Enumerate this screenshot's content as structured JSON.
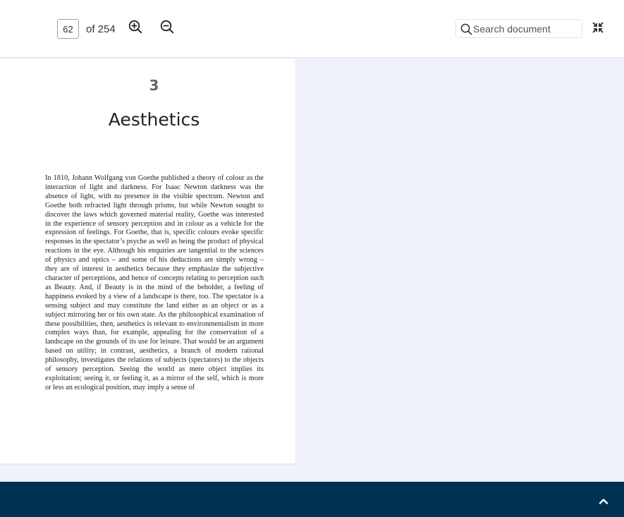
{
  "toolbar": {
    "current_page": "62",
    "page_count_label": "of 254",
    "zoom_in_icon": "zoom-in-icon",
    "zoom_out_icon": "zoom-out-icon",
    "search_placeholder": "Search document",
    "search_value": "",
    "exit_fullscreen_icon": "exit-fullscreen-icon"
  },
  "document": {
    "chapter_number": "3",
    "chapter_title": "Aesthetics",
    "body_text": "In 1810, Johann Wolfgang von Goethe published a theory of colour as the interaction of light and darkness. For Isaac Newton darkness was the absence of light, with no presence in the visible spectrum. Newton and Goethe both refracted light through prisms, but while Newton sought to discover the laws which governed material reality, Goethe was interested in the experience of sensory perception and in colour as a vehicle for the expression of feelings. For Goethe, that is, specific colours evoke specific responses in the spectator’s psyche as well as being the product of physical reactions in the eye. Although his enquiries are tangential to the sciences of physics and optics – and some of his deductions are simply wrong – they are of interest in aesthetics because they emphasize the subjective character of perceptions, and hence of concepts relating to perception such as Beauty. And, if Beauty is in the mind of the beholder, a feeling of happiness evoked by a view of a landscape is there, too. The spectator is a sensing subject and may constitute the land either as an object or as a subject mirroring her or his own state. As the philosophical examination of these possibilities, then, aesthetics is relevant to environmentalism in more complex ways than, for example, appealing for the conservation of a landscape on the grounds of its use for leisure. That would be an argument based on utility; in contrast, aesthetics, a branch of modern rational philosophy, investigates the relations of subjects (spectators) to the objects of sensory perception. Seeing the world as mere object implies its exploitation; seeing it, or feeling it, as a mirror of the self, which is more or less an ecological position, may imply a sense of"
  },
  "footer": {
    "back_to_top_icon": "chevron-up-icon"
  },
  "colors": {
    "toolbar_bg": "#ffffff",
    "viewer_bg": "#eff2fa",
    "footer_bg": "#003152"
  }
}
